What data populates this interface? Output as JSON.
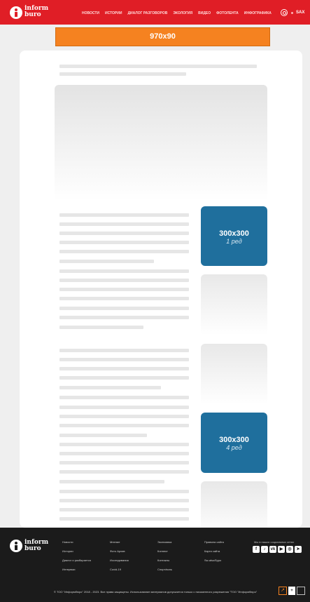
{
  "header": {
    "logo_line1": "inform",
    "logo_line2": "buro",
    "nav": [
      "НОВОСТИ",
      "ИСТОРИИ",
      "ДИАЛОГ РАЗГОВОРОВ",
      "ЭКОЛОГИЯ",
      "ВИДЕО",
      "ФОТОЛЕНТА",
      "ИНФОГРАФИКА"
    ],
    "lang": "SAX",
    "search_icon": "search-icon"
  },
  "top_ad": {
    "label": "970x90"
  },
  "ads": [
    {
      "size": "300x300",
      "note": "1 ред"
    },
    {
      "size": "300x300",
      "note": "4 ред"
    }
  ],
  "footer": {
    "logo_line1": "inform",
    "logo_line2": "buro",
    "columns": [
      [
        "Новости",
        "Истории",
        "Диалог и разбирается",
        "Интервью"
      ],
      [
        "Мнение",
        "Фото Архив",
        "Исследования",
        "Covid-19"
      ],
      [
        "Экономика",
        "Коннект",
        "Контакты",
        "Спорт/вопь"
      ],
      [
        "Правила сайта",
        "Карта сайта",
        "Sw-also/Буро"
      ]
    ],
    "social_title": "Мы в наших социальных сетях",
    "social_icons": [
      "facebook-icon",
      "tiktok-icon",
      "vk-icon",
      "youtube-icon",
      "instagram-icon",
      "telegram-icon"
    ],
    "copyright": "© ТОО \"Информбюро\" 2018 - 2023. Все права защищены. Использование материалов допускается только с письменного разрешения \"ТОО \"Информбюро\""
  }
}
